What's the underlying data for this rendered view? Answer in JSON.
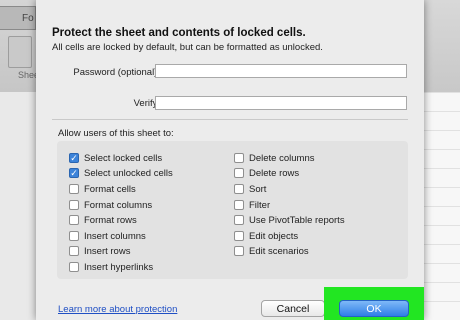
{
  "app": {
    "tab_label": "Fo",
    "sheet_label": "Shee"
  },
  "dialog": {
    "title": "Protect the sheet and contents of locked cells.",
    "subtitle": "All cells are locked by default, but can be formatted as unlocked.",
    "password": {
      "label": "Password (optional):",
      "value": ""
    },
    "verify": {
      "label": "Verify:",
      "value": ""
    },
    "allow_label": "Allow users of this sheet to:",
    "options_left": [
      {
        "label": "Select locked cells",
        "checked": true
      },
      {
        "label": "Select unlocked cells",
        "checked": true
      },
      {
        "label": "Format cells",
        "checked": false
      },
      {
        "label": "Format columns",
        "checked": false
      },
      {
        "label": "Format rows",
        "checked": false
      },
      {
        "label": "Insert columns",
        "checked": false
      },
      {
        "label": "Insert rows",
        "checked": false
      },
      {
        "label": "Insert hyperlinks",
        "checked": false
      }
    ],
    "options_right": [
      {
        "label": "Delete columns",
        "checked": false
      },
      {
        "label": "Delete rows",
        "checked": false
      },
      {
        "label": "Sort",
        "checked": false
      },
      {
        "label": "Filter",
        "checked": false
      },
      {
        "label": "Use PivotTable reports",
        "checked": false
      },
      {
        "label": "Edit objects",
        "checked": false
      },
      {
        "label": "Edit scenarios",
        "checked": false
      }
    ],
    "learn_link": "Learn more about protection",
    "cancel_label": "Cancel",
    "ok_label": "OK"
  },
  "colors": {
    "checkbox_checked": "#3c83d9",
    "ok_button": "#2f7ee6",
    "highlight": "#22e622",
    "link": "#1f4fc4"
  }
}
